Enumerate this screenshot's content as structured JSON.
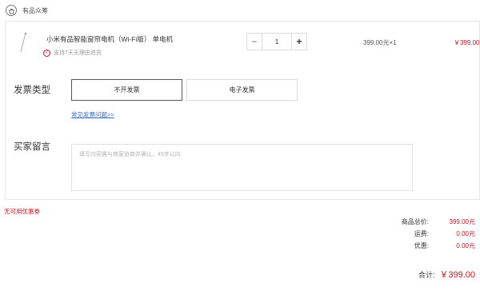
{
  "shop": {
    "icon": "shop-bag-icon",
    "name": "有品众筹"
  },
  "item": {
    "name": "小米有品智能窗帘电机（Wi-Fi版）  单电机",
    "return_note": "支持7天无理由退货",
    "quantity": "1",
    "minus_label": "−",
    "plus_label": "+",
    "unit_price": "399.00元×1",
    "line_total": "￥399.00"
  },
  "invoice": {
    "label": "发票类型",
    "options": [
      "不开发票",
      "电子发票"
    ],
    "selected": "不开发票",
    "faq_link": "常见发票问题>>"
  },
  "message": {
    "label": "买家留言",
    "placeholder": "填写内容需与商家协商并确认，45字以内"
  },
  "coupon_note": "无可用优惠券",
  "summary": {
    "subtotal_label": "商品总价:",
    "subtotal_value": "399.00元",
    "shipping_label": "运费:",
    "shipping_value": "0.00元",
    "discount_label": "优惠:",
    "discount_value": "0.00元",
    "total_label": "合计:",
    "total_value": "￥399.00"
  },
  "colors": {
    "accent_red": "#c81623",
    "link_blue": "#3a6fc4"
  }
}
